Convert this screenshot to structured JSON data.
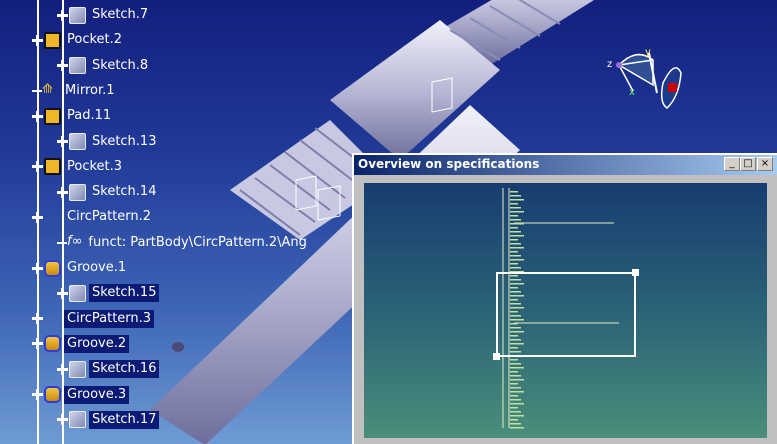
{
  "spec_tree": {
    "items": [
      {
        "label": "Sketch.7",
        "type": "sketch",
        "level": 2,
        "selected": false
      },
      {
        "label": "Pocket.2",
        "type": "pocket",
        "level": 1,
        "selected": false
      },
      {
        "label": "Sketch.8",
        "type": "sketch",
        "level": 2,
        "selected": false
      },
      {
        "label": "Mirror.1",
        "type": "mirror",
        "level": 1,
        "selected": false
      },
      {
        "label": "Pad.11",
        "type": "pad",
        "level": 1,
        "selected": false
      },
      {
        "label": "Sketch.13",
        "type": "sketch",
        "level": 2,
        "selected": false
      },
      {
        "label": "Pocket.3",
        "type": "pocket",
        "level": 1,
        "selected": false
      },
      {
        "label": "Sketch.14",
        "type": "sketch",
        "level": 2,
        "selected": false
      },
      {
        "label": "CircPattern.2",
        "type": "circpattern",
        "level": 1,
        "selected": false
      },
      {
        "label": "funct: PartBody\\CircPattern.2\\Ang",
        "type": "formula",
        "level": 2,
        "selected": false
      },
      {
        "label": "Groove.1",
        "type": "groove",
        "level": 1,
        "selected": false
      },
      {
        "label": "Sketch.15",
        "type": "sketch",
        "level": 2,
        "selected": true
      },
      {
        "label": "CircPattern.3",
        "type": "circpattern",
        "level": 1,
        "selected": true
      },
      {
        "label": "Groove.2",
        "type": "groove",
        "level": 1,
        "selected": true
      },
      {
        "label": "Sketch.16",
        "type": "sketch",
        "level": 2,
        "selected": true
      },
      {
        "label": "Groove.3",
        "type": "groove",
        "level": 1,
        "selected": true
      },
      {
        "label": "Sketch.17",
        "type": "sketch",
        "level": 2,
        "selected": true
      }
    ]
  },
  "overview_window": {
    "title": "Overview on specifications",
    "minimize_glyph": "_",
    "maximize_glyph": "□",
    "close_glyph": "×"
  },
  "compass": {
    "x_label": "x",
    "y_label": "y",
    "z_label": "z"
  },
  "icons": {
    "sketch": "sketch-icon",
    "pocket": "pocket-icon",
    "pad": "pad-icon",
    "mirror": "mirror-icon",
    "circpattern": "circ-pattern-icon",
    "groove": "groove-icon",
    "formula": "formula-icon"
  }
}
